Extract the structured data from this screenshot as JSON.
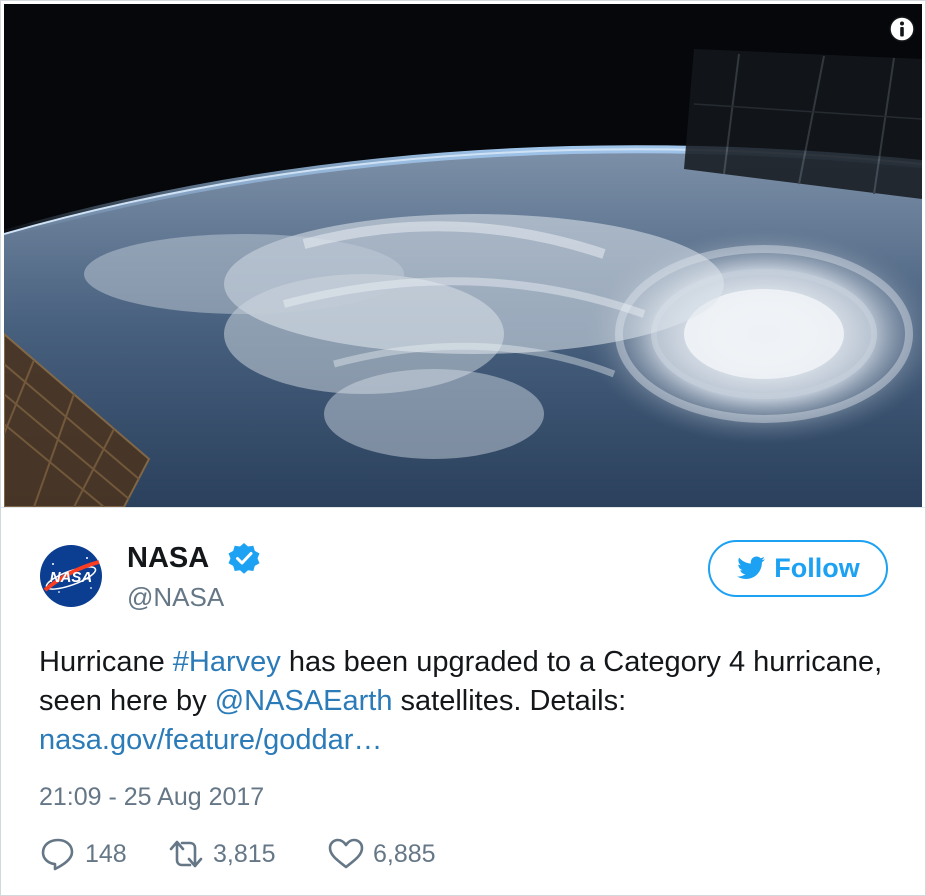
{
  "tweet": {
    "media": {
      "alt": "Hurricane Harvey seen from the International Space Station",
      "info_icon": "info-icon"
    },
    "author": {
      "display_name": "NASA",
      "handle": "@NASA",
      "avatar_text": "NASA",
      "verified_icon": "verified-badge-icon"
    },
    "follow_label": "Follow",
    "text": {
      "part1": "Hurricane ",
      "hashtag": "#Harvey",
      "part2": " has been upgraded to a Category 4 hurricane, seen here by ",
      "mention": "@NASAEarth",
      "part3": " satellites. Details: ",
      "link": "nasa.gov/feature/goddar…"
    },
    "timestamp": "21:09 - 25 Aug 2017",
    "actions": {
      "replies": "148",
      "retweets": "3,815",
      "likes": "6,885"
    },
    "colors": {
      "accent": "#1da1f2",
      "link": "#2b7bb9",
      "secondary_text": "#657786",
      "primary_text": "#14171a"
    }
  }
}
